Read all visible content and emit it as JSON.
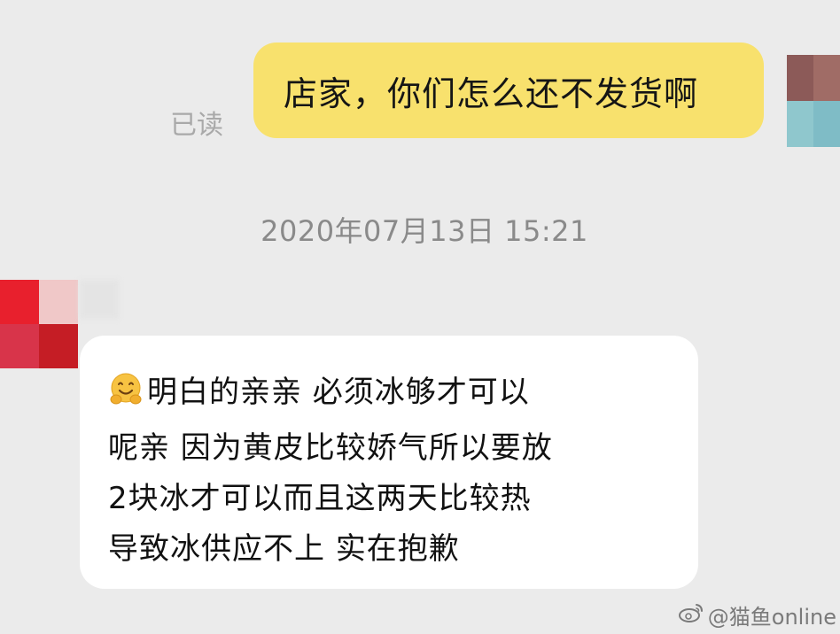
{
  "sent_message": {
    "text": "店家，你们怎么还不发货啊",
    "read_status": "已读"
  },
  "timestamp": "2020年07月13日 15:21",
  "received_message": {
    "emoji_icon": "smiling-hugging-face-icon",
    "lines": [
      "明白的亲亲 必须冰够才可以",
      "呢亲 因为黄皮比较娇气所以要放",
      "2块冰才可以而且这两天比较热",
      "导致冰供应不上 实在抱歉"
    ]
  },
  "watermark": {
    "icon": "weibo-logo-icon",
    "text": "@猫鱼online"
  },
  "colors": {
    "background": "#ebebeb",
    "sent_bubble": "#f8e16d",
    "received_bubble": "#ffffff",
    "read_status": "#a9a9a9",
    "timestamp": "#8a8a8a"
  }
}
